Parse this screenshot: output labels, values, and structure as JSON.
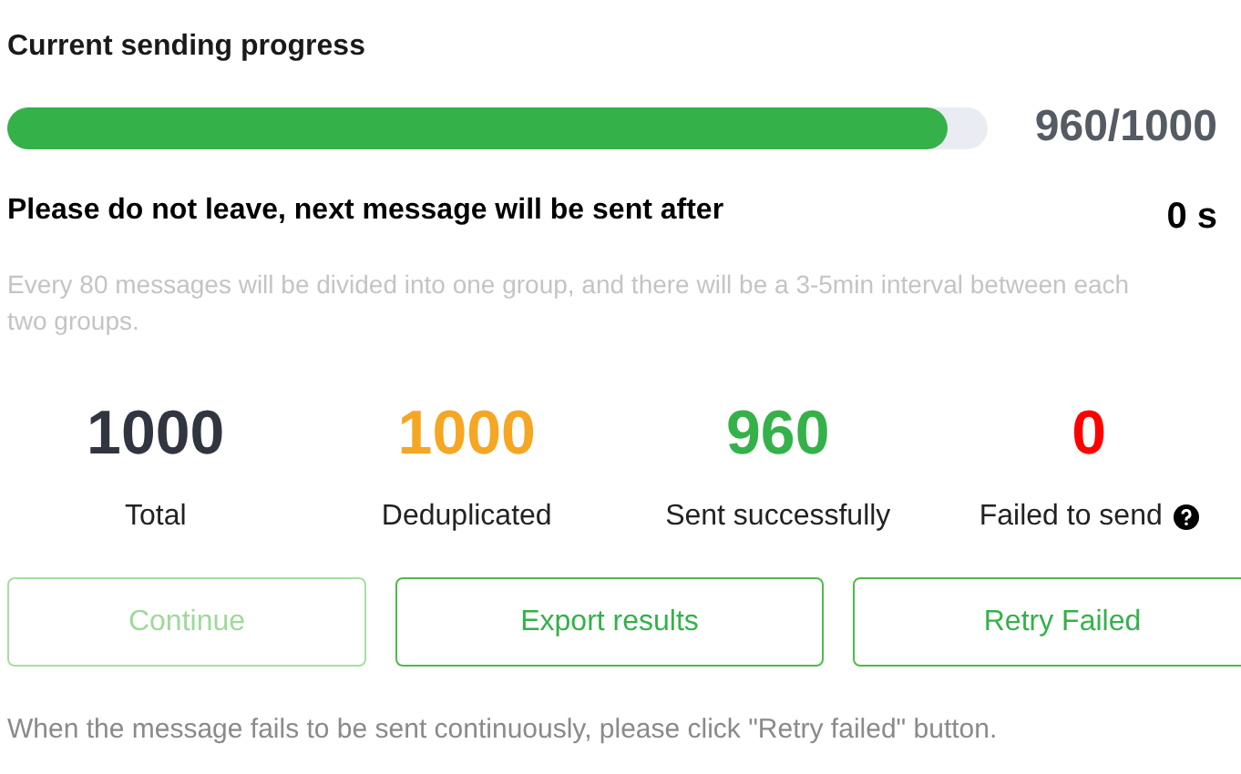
{
  "progress": {
    "title": "Current sending progress",
    "level": 0.96,
    "reading": "960/1000"
  },
  "wait": {
    "text": "Please do not leave, next message will be sent after",
    "countdown": "0 s"
  },
  "note": "Every 80 messages will be divided into one group, and there will be a 3-5min interval between each two groups.",
  "stats": [
    {
      "value": "1000",
      "label": "Total",
      "color": "#303540",
      "kind": "plain"
    },
    {
      "value": "1000",
      "label": "Deduplicated",
      "color": "#f5a623",
      "kind": "plain"
    },
    {
      "value": "960",
      "label": "Sent successfully",
      "color": "#35b14a",
      "kind": "plain"
    },
    {
      "value": "0",
      "label": "Failed to send",
      "color": "#ff0000",
      "kind": "with_help"
    }
  ],
  "buttons": [
    {
      "label": "Continue",
      "disabled": true
    },
    {
      "label": "Export results",
      "disabled": false
    },
    {
      "label": "Retry Failed",
      "disabled": false
    }
  ],
  "footer": "When the message fails to be sent continuously, please click \"Retry failed\" button."
}
